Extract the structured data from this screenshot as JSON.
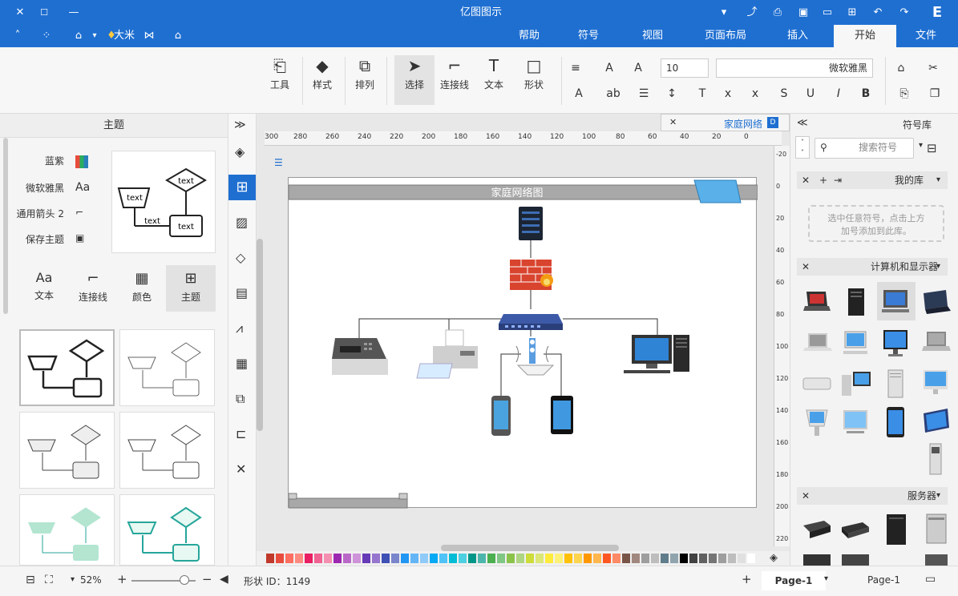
{
  "app": {
    "title": "亿图图示"
  },
  "tabs": [
    {
      "label": "文件"
    },
    {
      "label": "开始"
    },
    {
      "label": "插入"
    },
    {
      "label": "页面布局"
    },
    {
      "label": "视图"
    },
    {
      "label": "符号"
    },
    {
      "label": "帮助"
    }
  ],
  "user": {
    "name": "大米"
  },
  "ribbon": {
    "font_name": "微软雅黑",
    "font_size": "10",
    "shape": "形状",
    "text": "文本",
    "connector": "连接线",
    "select": "选择",
    "arrange": "排列",
    "style": "样式",
    "tools": "工具"
  },
  "symbol_panel": {
    "title": "符号库",
    "search_placeholder": "搜索符号",
    "my_library": "我的库",
    "my_library_hint_line1": "选中任意符号，点击上方",
    "my_library_hint_line2": "加号添加到此库。",
    "section_computers": "计算机和显示器",
    "section_servers": "服务器"
  },
  "doc_tab": {
    "label": "家庭网络"
  },
  "diagram": {
    "title": "家庭网络图"
  },
  "ruler_labels": [
    "0",
    "20",
    "40",
    "60",
    "80",
    "100",
    "120",
    "140",
    "160",
    "180",
    "200",
    "220",
    "240",
    "260",
    "280",
    "300"
  ],
  "vruler_labels": [
    "-20",
    "0",
    "20",
    "40",
    "60",
    "80",
    "100",
    "120",
    "140",
    "160",
    "180",
    "200",
    "220"
  ],
  "theme_panel": {
    "title": "主题",
    "options": [
      {
        "label": "蓝紫"
      },
      {
        "label": "微软雅黑"
      },
      {
        "label": "通用箭头 2"
      },
      {
        "label": "保存主题"
      }
    ],
    "tabs": [
      {
        "label": "主题"
      },
      {
        "label": "颜色"
      },
      {
        "label": "连接线"
      },
      {
        "label": "文本"
      }
    ],
    "preview_text": [
      "text",
      "text",
      "text",
      "text"
    ]
  },
  "status": {
    "page_select": "Page-1",
    "page_tab": "Page-1",
    "shape_id": "形状 ID：1149",
    "zoom": "52%"
  },
  "palette": [
    "#c0392b",
    "#e74c3c",
    "#ff6f61",
    "#ff8a80",
    "#e91e63",
    "#f06292",
    "#f48fb1",
    "#9c27b0",
    "#ba68c8",
    "#ce93d8",
    "#673ab7",
    "#9575cd",
    "#3f51b5",
    "#7986cb",
    "#2196f3",
    "#64b5f6",
    "#90caf9",
    "#03a9f4",
    "#4fc3f7",
    "#00bcd4",
    "#4dd0e1",
    "#009688",
    "#4db6ac",
    "#4caf50",
    "#81c784",
    "#8bc34a",
    "#aed581",
    "#cddc39",
    "#dce775",
    "#ffeb3b",
    "#fff176",
    "#ffc107",
    "#ffd54f",
    "#ff9800",
    "#ffb74d",
    "#ff5722",
    "#ff8a65",
    "#795548",
    "#a1887f",
    "#9e9e9e",
    "#bdbdbd",
    "#607d8b",
    "#90a4ae",
    "#000000",
    "#424242",
    "#616161",
    "#757575",
    "#9e9e9e",
    "#bdbdbd",
    "#e0e0e0",
    "#ffffff"
  ]
}
